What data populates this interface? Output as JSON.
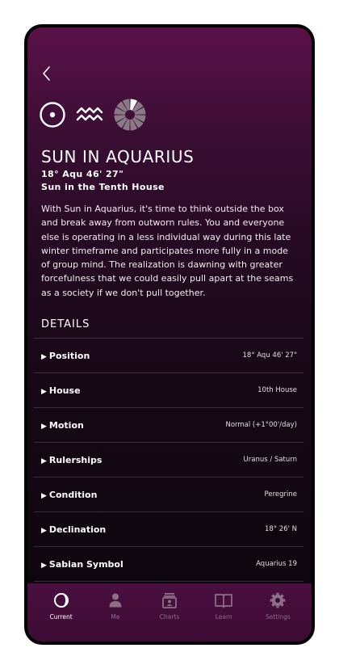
{
  "header": {
    "back_icon": "chevron-left-icon"
  },
  "glyphs": [
    "sun-symbol-icon",
    "aquarius-symbol-icon",
    "house-wheel-icon"
  ],
  "planet": {
    "title": "SUN IN AQUARIUS",
    "degree": "18° Aqu 46' 27\"",
    "house": "Sun in the Tenth House",
    "description": "With Sun in Aquarius, it's time to think outside the box and break away from outworn rules. You and everyone else is operating in a less individual way during this late winter timeframe and participates more fully in a mode of group mind. The realization is dawning with greater forcefulness that we could easily pull apart at the seams as a society if we don't pull together."
  },
  "details": {
    "heading": "DETAILS",
    "rows": [
      {
        "label": "Position",
        "value": "18° Aqu 46' 27\""
      },
      {
        "label": "House",
        "value": "10th House"
      },
      {
        "label": "Motion",
        "value": "Normal (+1°00'/day)"
      },
      {
        "label": "Rulerships",
        "value": "Uranus / Saturn"
      },
      {
        "label": "Condition",
        "value": "Peregrine"
      },
      {
        "label": "Declination",
        "value": "18° 26' N"
      },
      {
        "label": "Sabian Symbol",
        "value": "Aquarius 19"
      }
    ]
  },
  "tabbar": {
    "active": "Current",
    "tabs": [
      {
        "label": "Current",
        "icon": "moon-phase-icon"
      },
      {
        "label": "Me",
        "icon": "person-icon"
      },
      {
        "label": "Charts",
        "icon": "charts-icon"
      },
      {
        "label": "Learn",
        "icon": "book-icon"
      },
      {
        "label": "Settings",
        "icon": "gear-icon"
      }
    ]
  },
  "colors": {
    "background_top": "#5a1149",
    "background_bottom": "#0c050d",
    "tabbar": "#4a0f3f",
    "tab_inactive": "#8e6f89",
    "text": "#ffffff"
  }
}
